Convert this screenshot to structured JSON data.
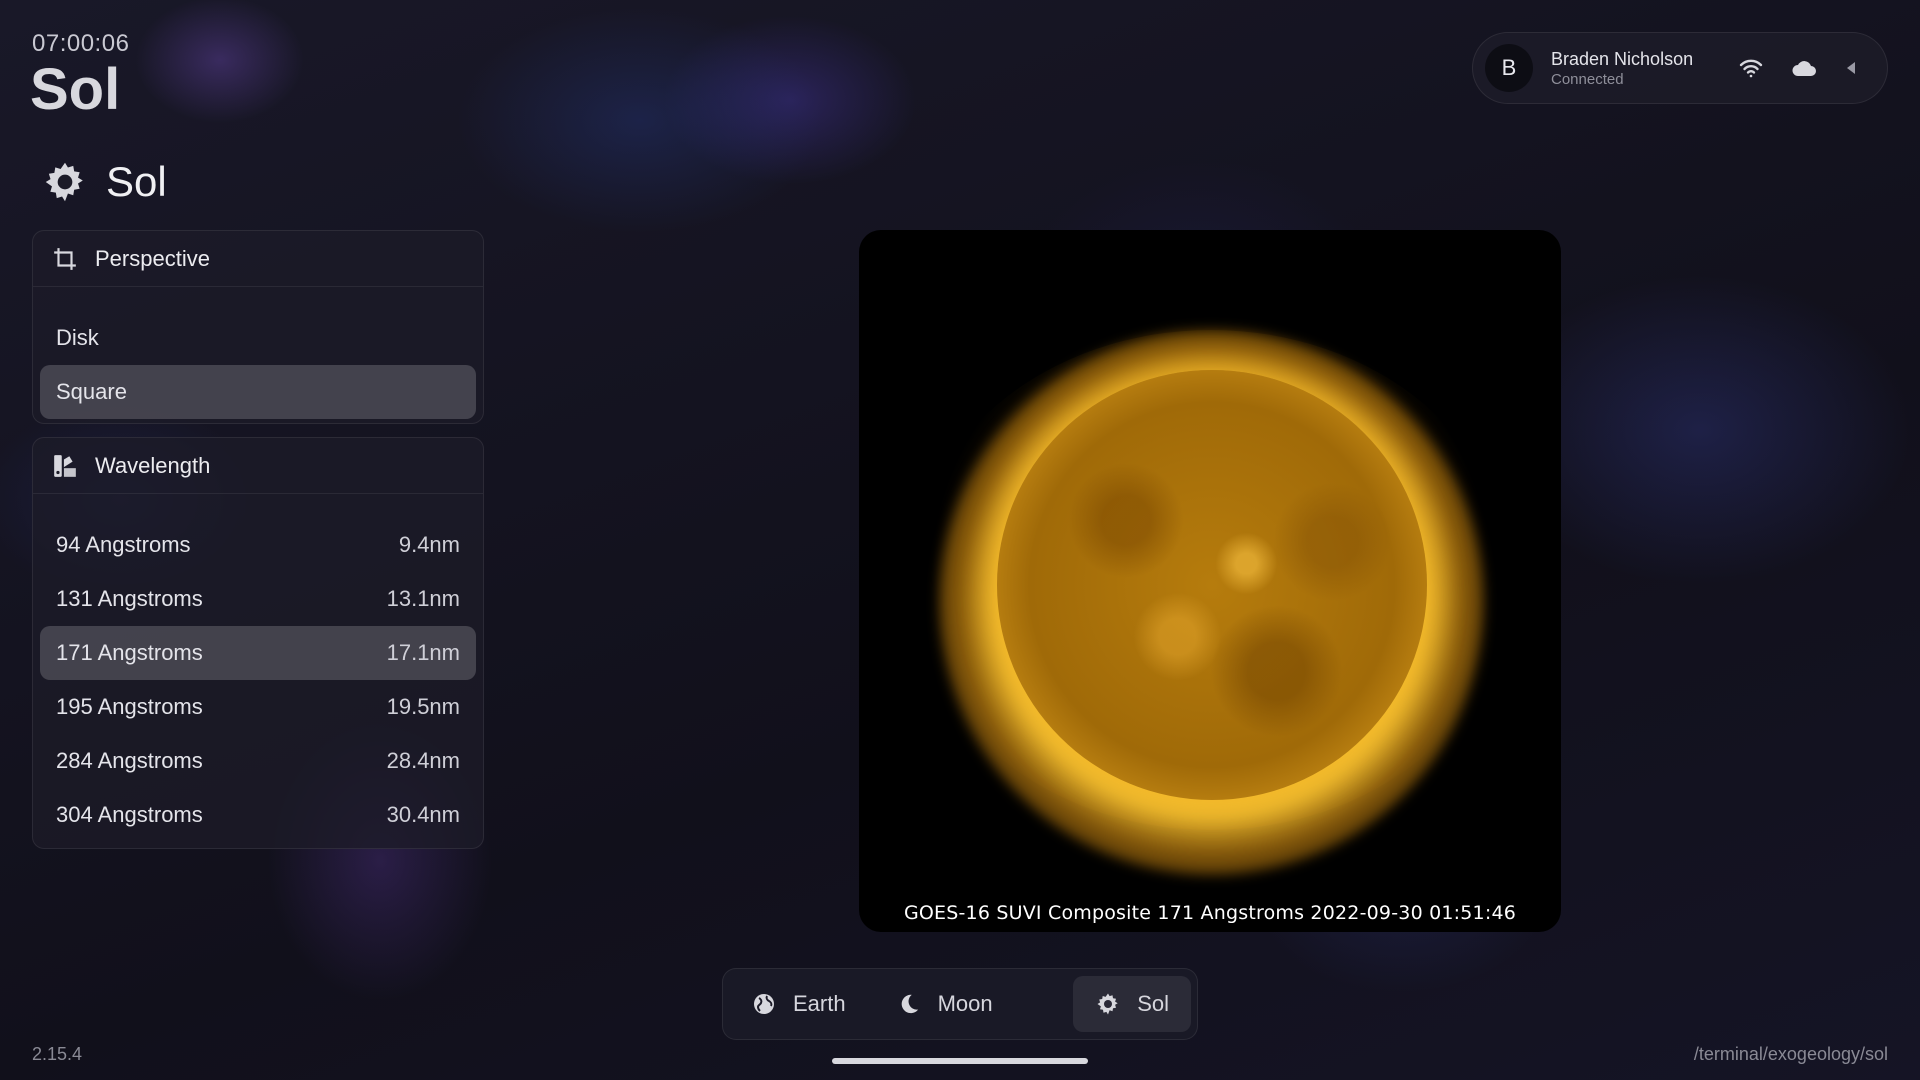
{
  "header": {
    "clock": "07:00:06",
    "title": "Sol"
  },
  "section": {
    "title": "Sol",
    "icon": "gear-sun-icon"
  },
  "perspective": {
    "title": "Perspective",
    "icon": "crop-icon",
    "options": [
      {
        "label": "Disk",
        "active": false
      },
      {
        "label": "Square",
        "active": true
      }
    ]
  },
  "wavelength": {
    "title": "Wavelength",
    "icon": "palette-ruler-icon",
    "options": [
      {
        "label": "94 Angstroms",
        "value": "9.4nm",
        "active": false
      },
      {
        "label": "131 Angstroms",
        "value": "13.1nm",
        "active": false
      },
      {
        "label": "171 Angstroms",
        "value": "17.1nm",
        "active": true
      },
      {
        "label": "195 Angstroms",
        "value": "19.5nm",
        "active": false
      },
      {
        "label": "284 Angstroms",
        "value": "28.4nm",
        "active": false
      },
      {
        "label": "304 Angstroms",
        "value": "30.4nm",
        "active": false
      }
    ]
  },
  "user": {
    "initial": "B",
    "name": "Braden Nicholson",
    "status": "Connected",
    "icons": [
      "wifi-icon",
      "cloud-icon",
      "caret-left-icon"
    ]
  },
  "viewer": {
    "caption": "GOES-16 SUVI Composite 171 Angstroms 2022-09-30 01:51:46",
    "sun_color": "#f2b630"
  },
  "tabs": [
    {
      "label": "Earth",
      "icon": "globe-icon",
      "active": false
    },
    {
      "label": "Moon",
      "icon": "moon-icon",
      "active": false
    },
    {
      "label": "Sol",
      "icon": "gear-sun-icon",
      "active": true
    }
  ],
  "footer": {
    "version": "2.15.4",
    "path": "/terminal/exogeology/sol"
  },
  "colors": {
    "background": "#14131f",
    "panel": "#1c1b28",
    "active_row": "#3a3a44"
  }
}
